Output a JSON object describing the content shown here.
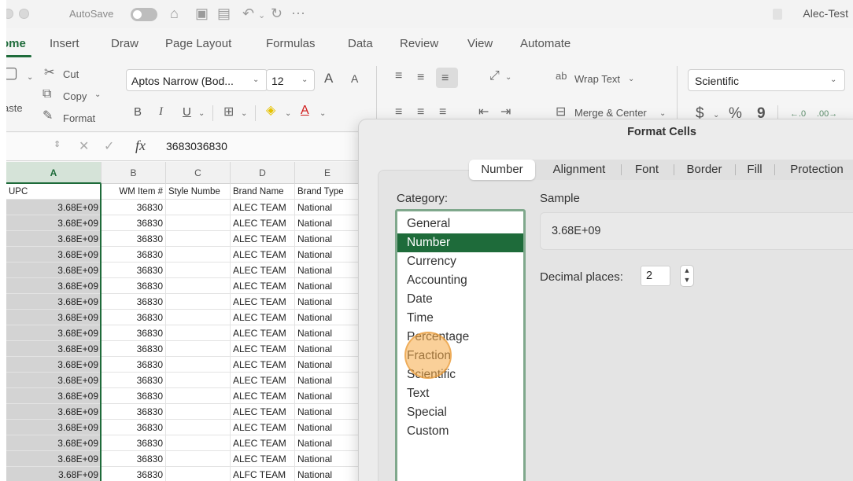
{
  "title_bar": {
    "autosave_label": "AutoSave",
    "doc_title": "Alec-Test"
  },
  "ribbon_tabs": [
    "ome",
    "Insert",
    "Draw",
    "Page Layout",
    "Formulas",
    "Data",
    "Review",
    "View",
    "Automate"
  ],
  "ribbon": {
    "paste_label": "aste",
    "cut_label": "Cut",
    "copy_label": "Copy",
    "format_label": "Format",
    "font_name": "Aptos Narrow (Bod...",
    "font_size": "12",
    "bold": "B",
    "italic": "I",
    "underline": "U",
    "grow_font": "A",
    "shrink_font": "A",
    "wrap_text_label": "Wrap Text",
    "merge_center_label": "Merge & Center",
    "number_format_value": "Scientific",
    "currency_symbol": "$",
    "percent_symbol": "%",
    "comma_symbol": "9",
    "fx_label": "fx"
  },
  "formula_bar": {
    "value": "3683036830"
  },
  "grid": {
    "columns": [
      "A",
      "B",
      "C",
      "D",
      "E"
    ],
    "header_row": [
      "UPC",
      "WM Item #",
      "Style Numbe",
      "Brand Name",
      "Brand Type"
    ],
    "rows": [
      [
        "3.68E+09",
        "36830",
        "",
        "ALEC TEAM",
        "National"
      ],
      [
        "3.68E+09",
        "36830",
        "",
        "ALEC TEAM",
        "National"
      ],
      [
        "3.68E+09",
        "36830",
        "",
        "ALEC TEAM",
        "National"
      ],
      [
        "3.68E+09",
        "36830",
        "",
        "ALEC TEAM",
        "National"
      ],
      [
        "3.68E+09",
        "36830",
        "",
        "ALEC TEAM",
        "National"
      ],
      [
        "3.68E+09",
        "36830",
        "",
        "ALEC TEAM",
        "National"
      ],
      [
        "3.68E+09",
        "36830",
        "",
        "ALEC TEAM",
        "National"
      ],
      [
        "3.68E+09",
        "36830",
        "",
        "ALEC TEAM",
        "National"
      ],
      [
        "3.68E+09",
        "36830",
        "",
        "ALEC TEAM",
        "National"
      ],
      [
        "3.68E+09",
        "36830",
        "",
        "ALEC TEAM",
        "National"
      ],
      [
        "3.68E+09",
        "36830",
        "",
        "ALEC TEAM",
        "National"
      ],
      [
        "3.68E+09",
        "36830",
        "",
        "ALEC TEAM",
        "National"
      ],
      [
        "3.68E+09",
        "36830",
        "",
        "ALEC TEAM",
        "National"
      ],
      [
        "3.68E+09",
        "36830",
        "",
        "ALEC TEAM",
        "National"
      ],
      [
        "3.68E+09",
        "36830",
        "",
        "ALEC TEAM",
        "National"
      ],
      [
        "3.68E+09",
        "36830",
        "",
        "ALEC TEAM",
        "National"
      ],
      [
        "3.68E+09",
        "36830",
        "",
        "ALEC TEAM",
        "National"
      ],
      [
        "3.68F+09",
        "36830",
        "",
        "ALFC TEAM",
        "National"
      ]
    ]
  },
  "dialog": {
    "title": "Format Cells",
    "tabs": [
      "Number",
      "Alignment",
      "Font",
      "Border",
      "Fill",
      "Protection"
    ],
    "active_tab": "Number",
    "category_label": "Category:",
    "categories": [
      "General",
      "Number",
      "Currency",
      "Accounting",
      "Date",
      "Time",
      "Percentage",
      "Fraction",
      "Scientific",
      "Text",
      "Special",
      "Custom"
    ],
    "selected_category": "Number",
    "sample_label": "Sample",
    "sample_value": "3.68E+09",
    "decimal_places_label": "Decimal places:",
    "decimal_places_value": "2"
  },
  "colors": {
    "excel_green": "#1e6b3a",
    "selection_column": "#d3d3d3",
    "cursor_highlight": "#f5aa46"
  }
}
